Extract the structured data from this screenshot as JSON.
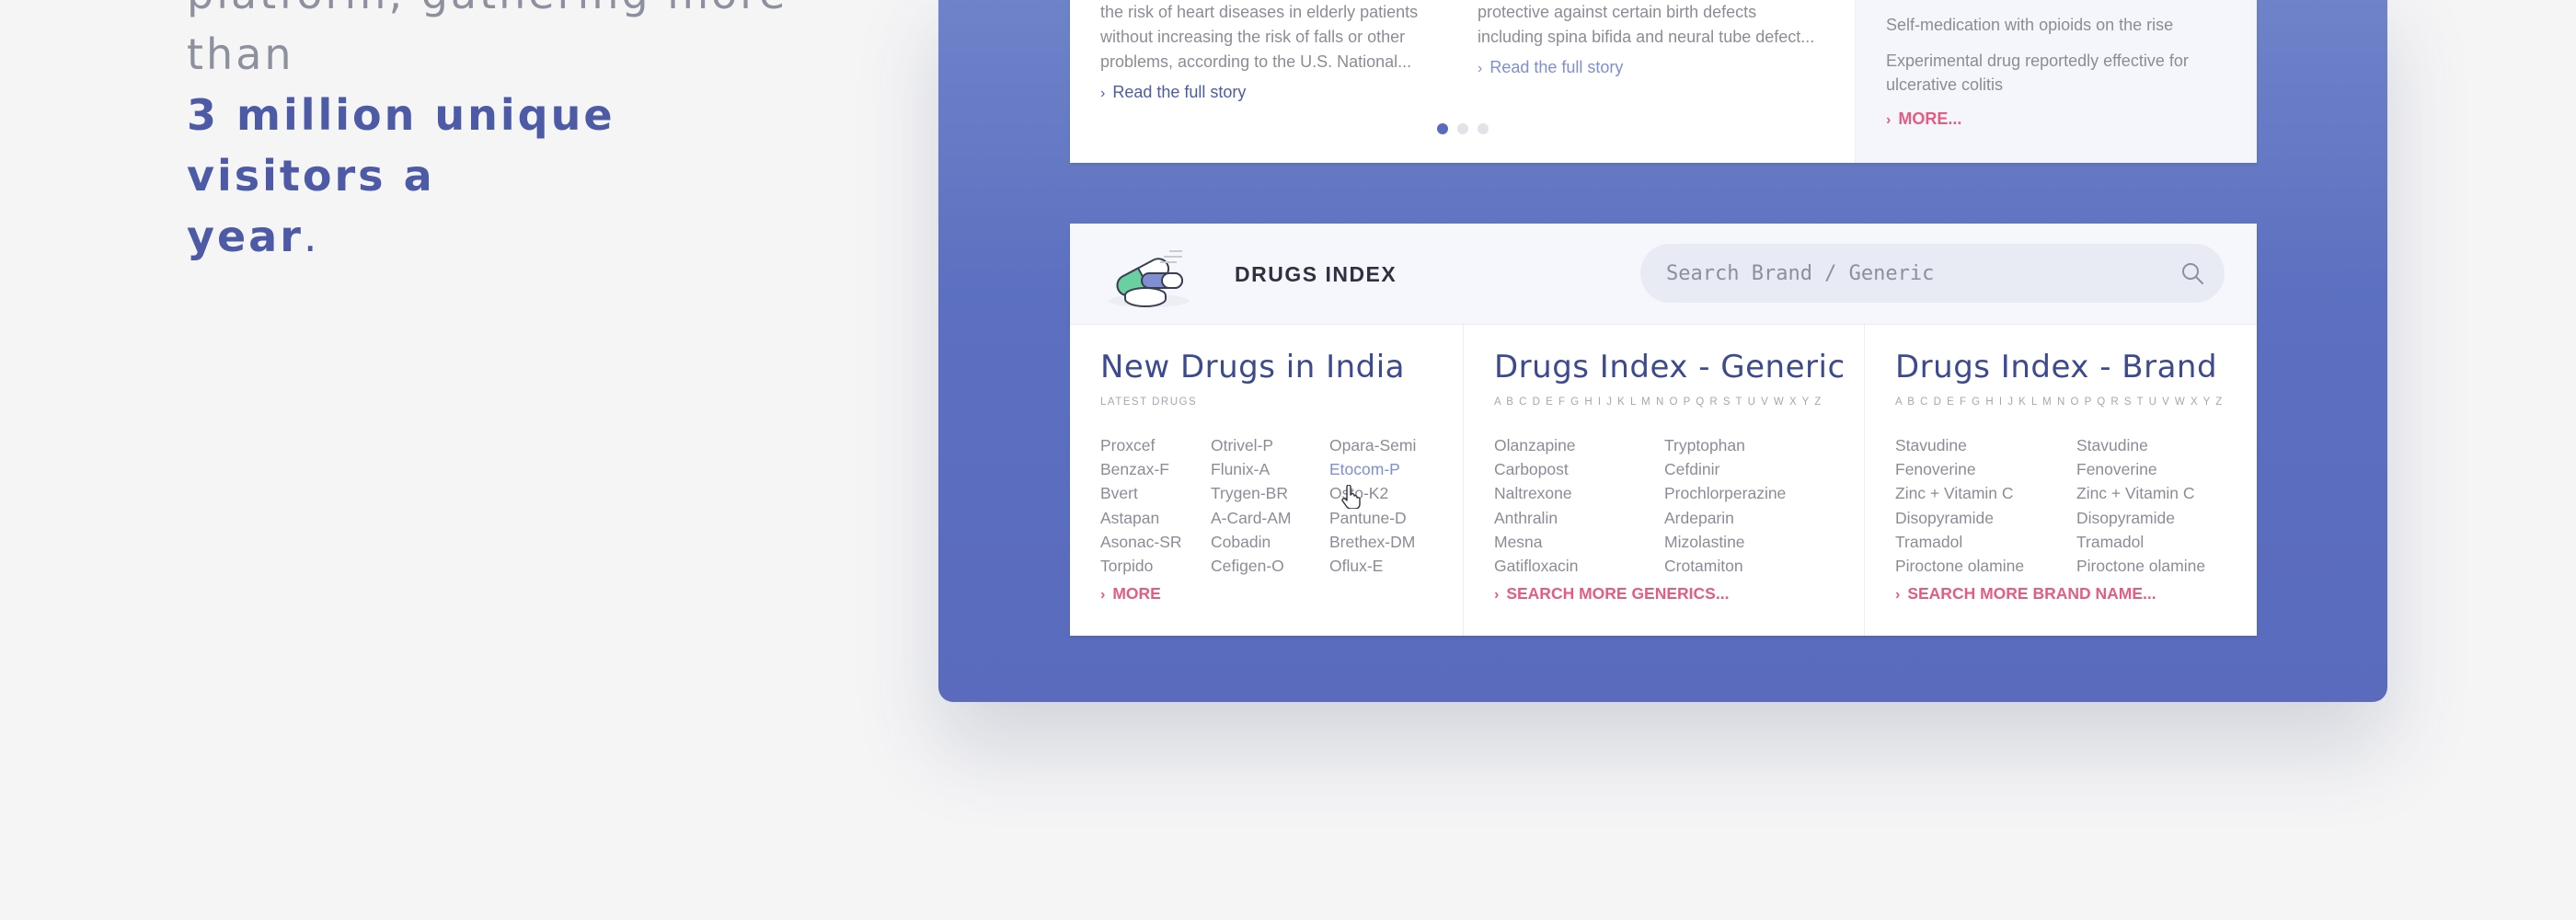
{
  "hero": {
    "line1": "platform, gathering more than",
    "highlight_line2": "3 million unique visitors a",
    "highlight_line3": "year",
    "period": "."
  },
  "news": {
    "col1": {
      "lines": [
        "the risk of heart diseases in elderly patients",
        "without increasing the risk of falls or other",
        "problems, according to the U.S. National..."
      ],
      "link": "Read the full story"
    },
    "col2": {
      "lines": [
        "protective against certain birth defects",
        "including spina bifida and neural tube defect..."
      ],
      "link": "Read the full story"
    },
    "side": {
      "item1": "Self-medication with opioids on the rise",
      "item2": "Experimental drug reportedly effective for ulcerative colitis",
      "more": "MORE..."
    },
    "carousel_active": 1
  },
  "drugs_index": {
    "title": "DRUGS INDEX",
    "search": {
      "placeholder": "Search Brand / Generic",
      "value": ""
    },
    "new_drugs": {
      "title": "New Drugs in India",
      "subtitle": "LATEST DRUGS",
      "list1": [
        "Proxcef",
        "Benzax-F",
        "Bvert",
        "Astapan",
        "Asonac-SR",
        "Torpido"
      ],
      "list2": [
        "Otrivel-P",
        "Flunix-A",
        "Trygen-BR",
        "A-Card-AM",
        "Cobadin",
        "Cefigen-O"
      ],
      "list3": [
        "Opara-Semi",
        "Etocom-P",
        "Osto-K2",
        "Pantune-D",
        "Brethex-DM",
        "Oflux-E"
      ],
      "more": "MORE"
    },
    "generic": {
      "title": "Drugs Index - Generic",
      "alphabet": "A B C D E F G H I J K L M N O P Q R S T U V W X Y Z",
      "list1": [
        "Olanzapine",
        "Carbopost",
        "Naltrexone",
        "Anthralin",
        "Mesna",
        "Gatifloxacin"
      ],
      "list2": [
        "Tryptophan",
        "Cefdinir",
        "Prochlorperazine",
        "Ardeparin",
        "Mizolastine",
        "Crotamiton"
      ],
      "more": "SEARCH MORE GENERICS..."
    },
    "brand": {
      "title": "Drugs Index - Brand",
      "alphabet": "A B C D E F G H I J K L M N O P Q R S T U V W X Y Z",
      "list1": [
        "Stavudine",
        "Fenoverine",
        "Zinc + Vitamin C",
        "Disopyramide",
        "Tramadol",
        "Piroctone olamine"
      ],
      "list2": [
        "Stavudine",
        "Fenoverine",
        "Zinc + Vitamin C",
        "Disopyramide",
        "Tramadol",
        "Piroctone olamine"
      ],
      "more": "SEARCH MORE BRAND NAME..."
    }
  },
  "colors": {
    "brand_blue": "#4d5ba6",
    "panel_blue": "#5c6fc0",
    "accent_pink": "#e35d82",
    "link_blue": "#7f8fd2"
  },
  "icons": [
    "chevron-right-icon",
    "search-icon",
    "pills-icon",
    "hand-pointer-icon"
  ]
}
